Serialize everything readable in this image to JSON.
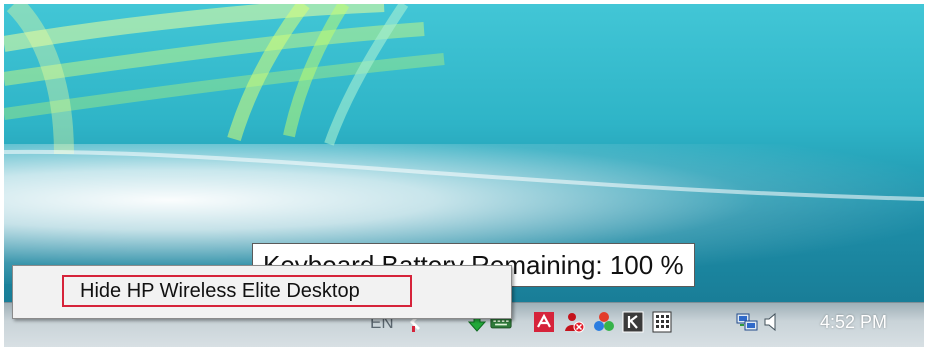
{
  "tooltip": {
    "text": "Keyboard Battery Remaining: 100 %"
  },
  "context_menu": {
    "items": [
      {
        "label": "Hide HP Wireless Elite Desktop"
      }
    ]
  },
  "taskbar": {
    "language": "EN",
    "clock": "4:52 PM",
    "tray_icons": [
      "arrow-icon",
      "green-arrow-icon",
      "keyboard-icon",
      "avira-icon",
      "user-error-icon",
      "colored-balls-icon",
      "k-icon",
      "grid-icon",
      "network-icon",
      "speaker-icon"
    ]
  },
  "colors": {
    "accent_red": "#d6233a",
    "desktop_teal": "#2eb4c7"
  }
}
